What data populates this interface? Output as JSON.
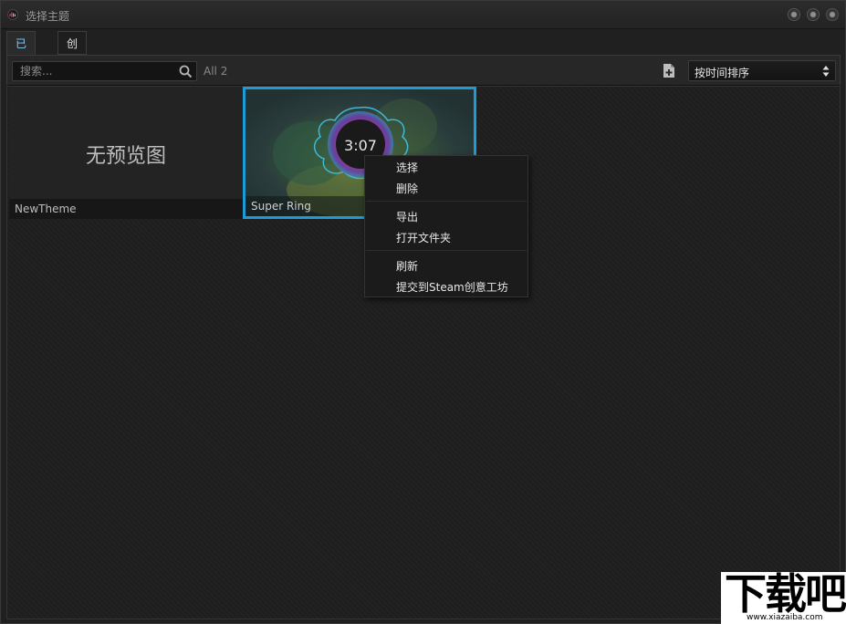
{
  "window": {
    "title": "选择主题"
  },
  "tabs": [
    {
      "label": "已安装",
      "active": true
    },
    {
      "label": "创意工坊",
      "active": false
    }
  ],
  "toolbar": {
    "search_placeholder": "搜索...",
    "count": "All 2",
    "sort_label": "按时间排序"
  },
  "themes": [
    {
      "name": "NewTheme",
      "preview_text": "无预览图",
      "selected": false
    },
    {
      "name": "Super Ring",
      "selected": true,
      "clock": "3:07"
    }
  ],
  "context_menu": {
    "items": [
      "选择",
      "删除",
      "导出",
      "打开文件夹",
      "刷新",
      "提交到Steam创意工坊"
    ]
  },
  "watermark": {
    "text": "下载吧",
    "url": "www.xiazaiba.com"
  },
  "colors": {
    "accent": "#1e9bd7",
    "active_tab": "#7fd0ff"
  }
}
